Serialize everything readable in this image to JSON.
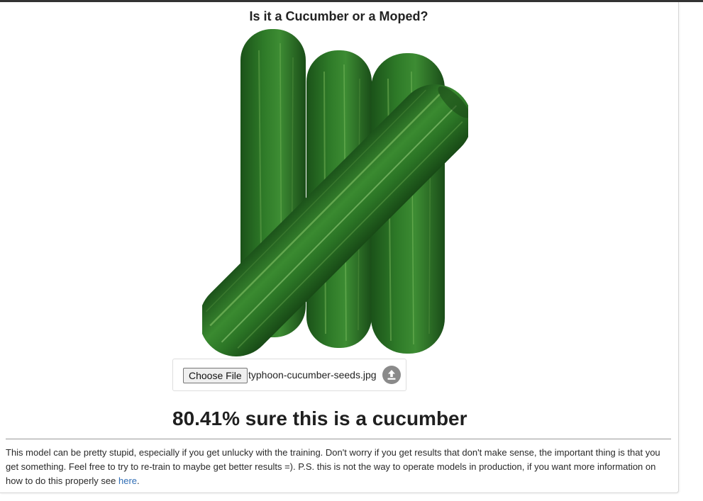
{
  "page": {
    "title": "Is it a Cucumber or a Moped?"
  },
  "preview": {
    "subject_icon": "cucumber-image"
  },
  "upload": {
    "choose_label": "Choose File",
    "file_name": "typhoon-cucumber-seeds.jpg",
    "submit_icon": "upload-icon"
  },
  "result": {
    "text": "80.41% sure this is a cucumber",
    "confidence_percent": 80.41,
    "label": "cucumber"
  },
  "note": {
    "text": "This model can be pretty stupid, especially if you get unlucky with the training. Don't worry if you get results that don't make sense, the important thing is that you get something. Feel free to try to re-train to maybe get better results =). P.S. this is not the way to operate models in production, if you want more information on how to do this properly see ",
    "link_text": "here",
    "tail": "."
  },
  "colors": {
    "link": "#2f6db5",
    "upload_icon": "#888888",
    "cucumber_dark": "#1e5a1e",
    "cucumber_mid": "#2f7a2a"
  }
}
